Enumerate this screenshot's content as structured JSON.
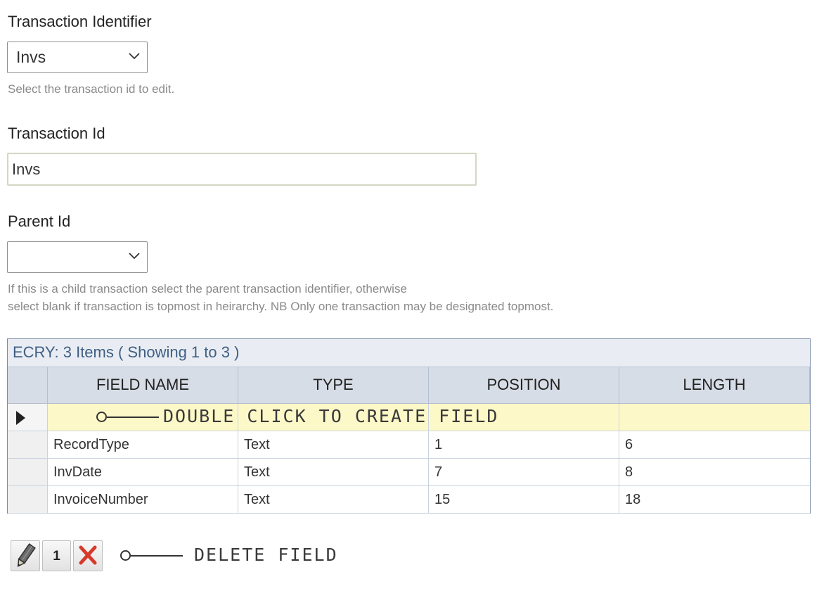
{
  "form": {
    "transaction_identifier": {
      "label": "Transaction Identifier",
      "selected": "Invs",
      "help": "Select the transaction id to edit."
    },
    "transaction_id": {
      "label": "Transaction Id",
      "value": "Invs"
    },
    "parent_id": {
      "label": "Parent Id",
      "selected": "",
      "help_line1": "If this is a child transaction select the parent transaction identifier, otherwise",
      "help_line2": "select blank if transaction is topmost in heirarchy. NB Only one transaction may be designated topmost."
    }
  },
  "grid": {
    "caption": "ECRY: 3 Items ( Showing 1 to 3 )",
    "columns": [
      "FIELD NAME",
      "TYPE",
      "POSITION",
      "LENGTH"
    ],
    "rows": [
      {
        "field_name": "RecordType",
        "type": "Text",
        "position": "1",
        "length": "6"
      },
      {
        "field_name": "InvDate",
        "type": "Text",
        "position": "7",
        "length": "8"
      },
      {
        "field_name": "InvoiceNumber",
        "type": "Text",
        "position": "15",
        "length": "18"
      }
    ]
  },
  "toolbar": {
    "edit_icon": "pencil-icon",
    "page_number": "1",
    "delete_icon": "red-x-icon"
  },
  "annotations": {
    "create_field": "DOUBLE CLICK TO CREATE FIELD",
    "delete_field": "DELETE FIELD"
  },
  "colors": {
    "caption_text": "#3f5f84",
    "new_row_bg": "#fcf8c8",
    "header_bg": "#d7dde6",
    "delete_red": "#d63a2a"
  }
}
